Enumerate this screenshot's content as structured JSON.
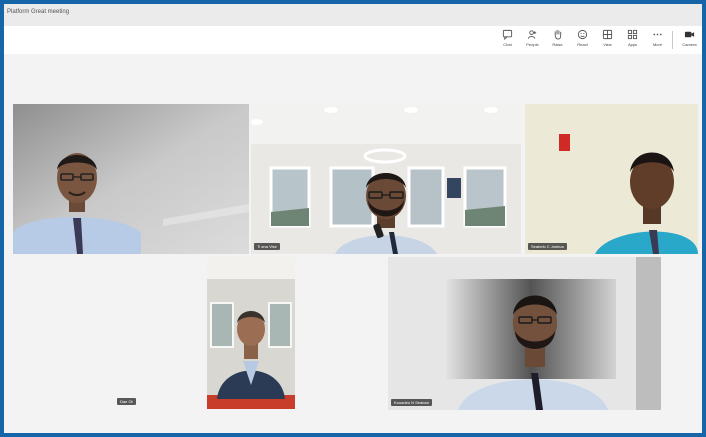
{
  "window": {
    "title": "Platform Great meeting"
  },
  "toolbar": {
    "buttons": [
      {
        "label": "Chat",
        "icon": "chat-icon"
      },
      {
        "label": "People",
        "icon": "people-icon"
      },
      {
        "label": "Raise",
        "icon": "hand-icon"
      },
      {
        "label": "React",
        "icon": "react-icon"
      },
      {
        "label": "View",
        "icon": "view-icon"
      },
      {
        "label": "Apps",
        "icon": "apps-icon"
      },
      {
        "label": "More",
        "icon": "more-icon"
      },
      {
        "label": "Camera",
        "icon": "camera-icon"
      }
    ]
  },
  "participants": {
    "p1": {
      "name": ""
    },
    "p2": {
      "name": "Ti ana Vise"
    },
    "p3": {
      "name": "Seabelo C Joshua"
    },
    "p4": {
      "name": "Dae Ot"
    },
    "p5": {
      "name": "Kouadeo N Seaban"
    }
  },
  "colors": {
    "frame_border": "#1565a8",
    "stage": "#f3f3f3"
  }
}
